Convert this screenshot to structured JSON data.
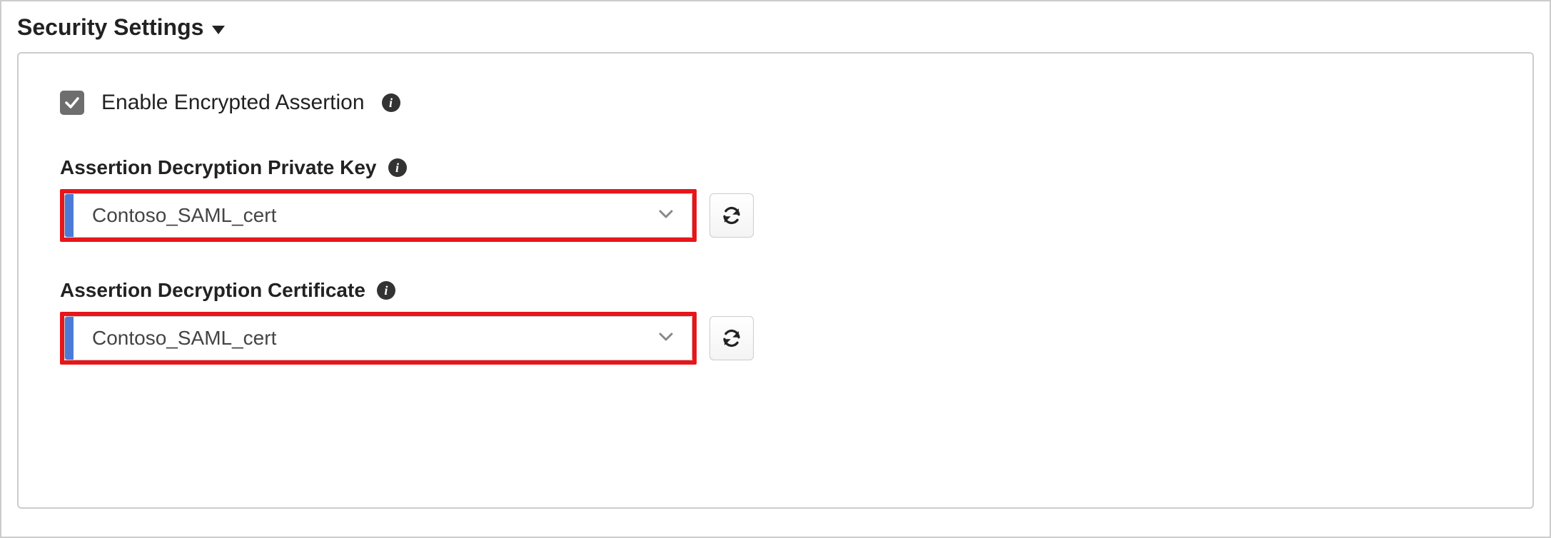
{
  "section": {
    "title": "Security Settings"
  },
  "checkbox": {
    "checked": true,
    "label": "Enable Encrypted Assertion"
  },
  "fields": {
    "privateKey": {
      "label": "Assertion Decryption Private Key",
      "value": "Contoso_SAML_cert"
    },
    "certificate": {
      "label": "Assertion Decryption Certificate",
      "value": "Contoso_SAML_cert"
    }
  },
  "icons": {
    "info_glyph": "i"
  }
}
